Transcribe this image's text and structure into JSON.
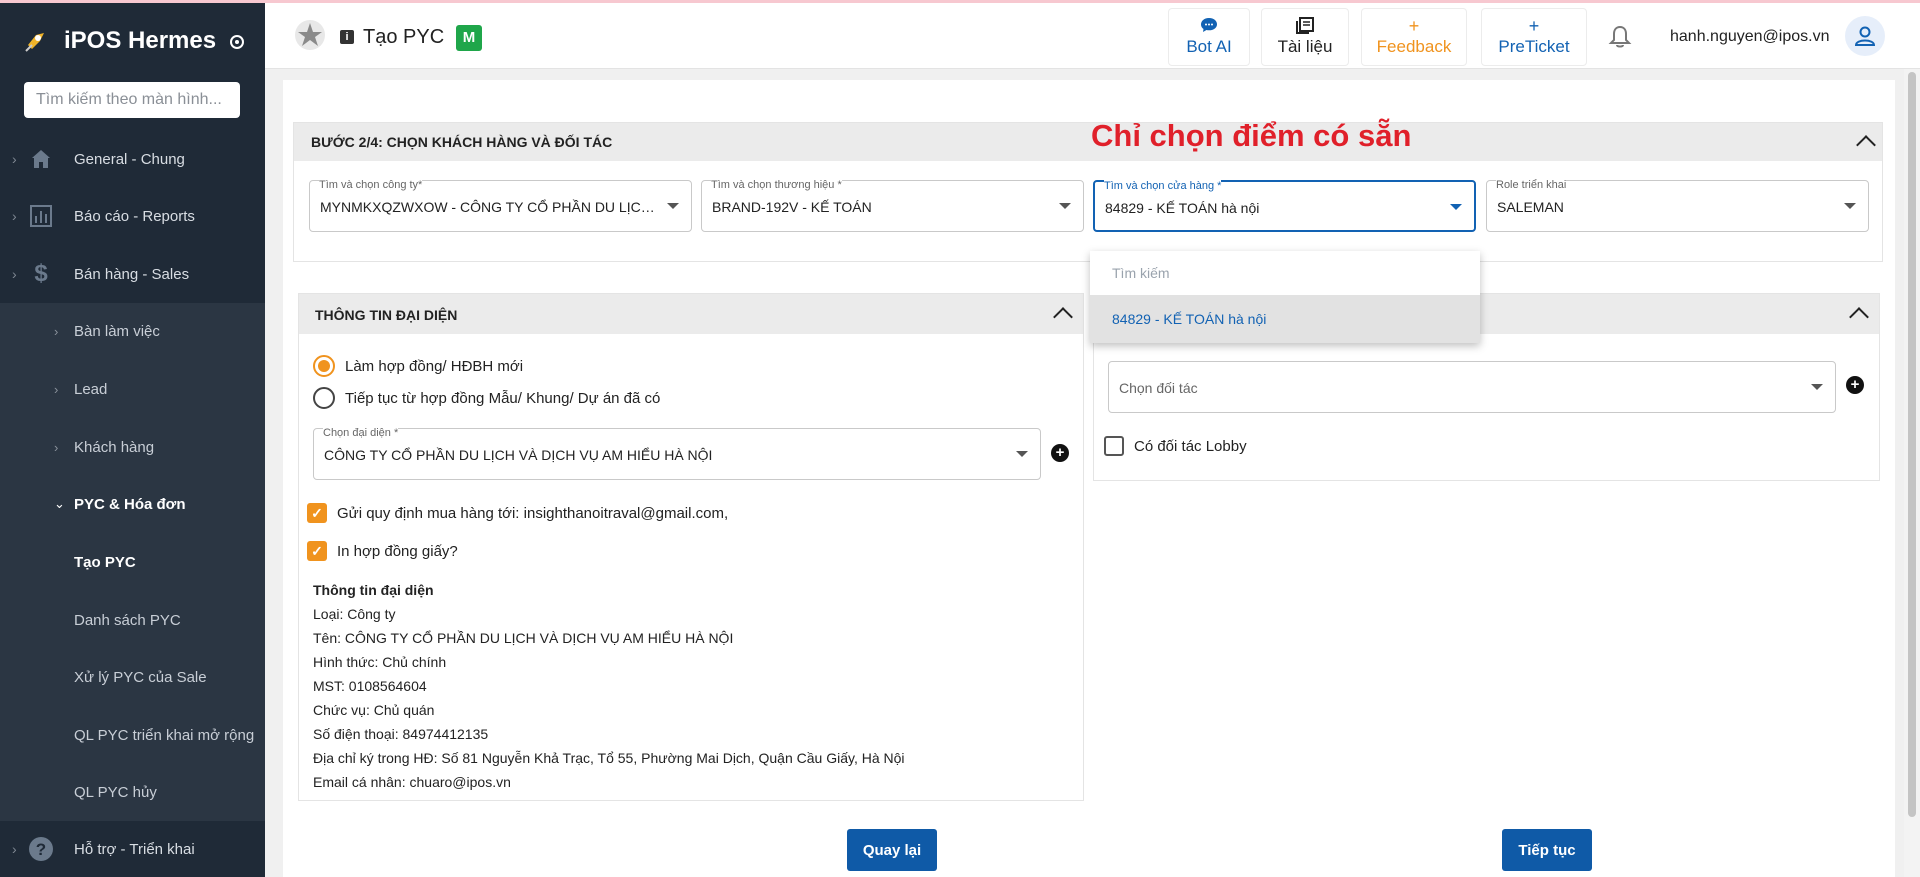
{
  "sidebar": {
    "app_name": "iPOS Hermes",
    "search_placeholder": "Tìm kiếm theo màn hình...",
    "items": [
      {
        "label": "General - Chung",
        "icon": "home-icon"
      },
      {
        "label": "Báo cáo - Reports",
        "icon": "bar-chart-icon"
      },
      {
        "label": "Bán hàng - Sales",
        "icon": "dollar-icon"
      }
    ],
    "sales_sub": [
      {
        "label": "Bàn làm việc"
      },
      {
        "label": "Lead"
      },
      {
        "label": "Khách hàng"
      },
      {
        "label": "PYC & Hóa đơn"
      }
    ],
    "pyc_sub": [
      {
        "label": "Tạo PYC"
      },
      {
        "label": "Danh sách PYC"
      },
      {
        "label": "Xử lý PYC của Sale"
      },
      {
        "label": "QL PYC triển khai mở rộng"
      },
      {
        "label": "QL PYC hủy"
      }
    ],
    "support": {
      "label": "Hỗ trợ - Triển khai",
      "icon": "help-icon"
    }
  },
  "header": {
    "info_glyph": "i",
    "title": "Tạo PYC",
    "badge": "M",
    "buttons": [
      {
        "label": "Bot AI",
        "glyph": "💬"
      },
      {
        "label": "Tài liệu",
        "glyph": "▤"
      },
      {
        "label": "Feedback",
        "glyph": "+"
      },
      {
        "label": "PreTicket",
        "glyph": "+"
      }
    ],
    "user_email": "hanh.nguyen@ipos.vn"
  },
  "annotation": "Chỉ chọn điểm có sẵn",
  "step": {
    "title": "BƯỚC 2/4: CHỌN KHÁCH HÀNG VÀ ĐỐI TÁC",
    "fields": [
      {
        "label": "Tìm và chọn công ty*",
        "value": "MYNMKXQZWXOW - CÔNG TY CỔ PHẦN DU LỊCH VÀ DỊCH VỤ AM HIỂU HÀ NỘI"
      },
      {
        "label": "Tìm và chọn thương hiệu *",
        "value": "BRAND-192V - KẾ TOÁN"
      },
      {
        "label": "Tìm và chọn cửa hàng *",
        "value": "84829 - KẾ TOÁN hà nội"
      },
      {
        "label": "Role triển khai",
        "value": "SALEMAN"
      }
    ]
  },
  "dropdown": {
    "search_placeholder": "Tìm kiếm",
    "options": [
      "84829 - KẾ TOÁN hà nội"
    ]
  },
  "rep_panel": {
    "title": "THÔNG TIN ĐẠI DIỆN",
    "radio_new": "Làm hợp đồng/ HĐBH mới",
    "radio_continue": "Tiếp tục từ hợp đồng Mẫu/ Khung/ Dự án đã có",
    "rep_field_label": "Chọn đại diện *",
    "rep_field_value": "CÔNG TY CỔ PHẦN DU LỊCH VÀ DỊCH VỤ AM HIỂU HÀ NỘI",
    "check_send": "Gửi quy định mua hàng tới: insighthanoitraval@gmail.com,",
    "check_print": "In hợp đồng giấy?",
    "info_title": "Thông tin đại diện",
    "info_lines": [
      "Loại: Công ty",
      "Tên: CÔNG TY CỔ PHẦN DU LỊCH VÀ DỊCH VỤ AM HIỂU HÀ NỘI",
      "Hình thức: Chủ chính",
      "MST: 0108564604",
      "Chức vụ: Chủ quán",
      "Số điện thoại: 84974412135",
      "Địa chỉ ký trong HĐ: Số 81 Nguyễn Khả Trạc, Tổ 55, Phường Mai Dịch, Quận Cầu Giấy, Hà Nội",
      "Email cá nhân: chuaro@ipos.vn"
    ]
  },
  "partner_panel": {
    "partner_placeholder": "Chọn đối tác",
    "check_lobby": "Có đối tác Lobby"
  },
  "actions": {
    "back": "Quay lại",
    "next": "Tiếp tục"
  },
  "colors": {
    "sidebar_bg": "#1f2a37",
    "primary": "#0f5aa7",
    "accent_orange": "#f0931e",
    "annotation_red": "#e0202a"
  }
}
